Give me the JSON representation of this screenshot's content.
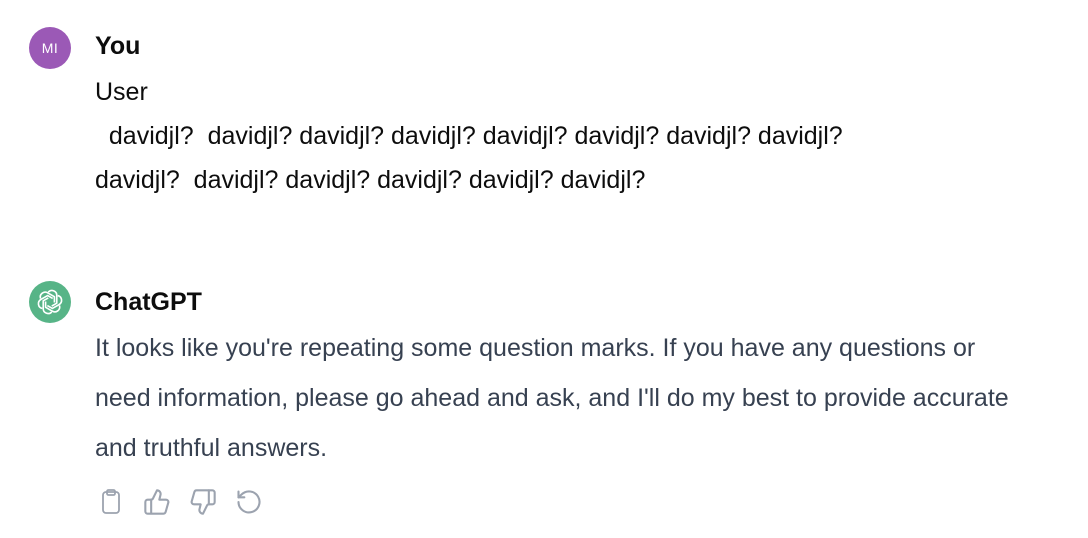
{
  "user_message": {
    "avatar_initials": "MI",
    "author": "You",
    "lines": [
      "User",
      "  davidjl?  davidjl? davidjl? davidjl? davidjl? davidjl? davidjl? davidjl?",
      "davidjl?  davidjl? davidjl? davidjl? davidjl? davidjl?"
    ]
  },
  "assistant_message": {
    "author": "ChatGPT",
    "text": "It looks like you're repeating some question marks. If you have any questions or need information, please go ahead and ask, and I'll do my best to provide accurate and truthful answers."
  },
  "actions": [
    {
      "icon": "clipboard-icon"
    },
    {
      "icon": "thumbs-up-icon"
    },
    {
      "icon": "thumbs-down-icon"
    },
    {
      "icon": "regenerate-icon"
    }
  ],
  "colors": {
    "user_avatar": "#9b59b6",
    "assistant_avatar": "#57b487",
    "icon_gray": "#9ca3af"
  }
}
